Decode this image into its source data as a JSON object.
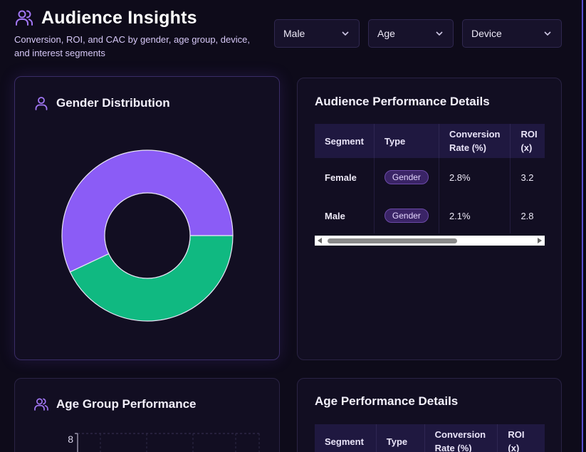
{
  "header": {
    "title": "Audience Insights",
    "subtitle": "Conversion, ROI, and CAC by gender, age group, device, and interest segments"
  },
  "filters": {
    "gender": "Male",
    "age": "Age",
    "device": "Device"
  },
  "gender_card": {
    "title": "Gender Distribution",
    "chart_data": {
      "type": "pie",
      "title": "",
      "categories": [
        "Female",
        "Male"
      ],
      "values": [
        57,
        43
      ],
      "colors": [
        "#8b5cf6",
        "#10b981"
      ],
      "legend": "none"
    }
  },
  "audience_table": {
    "title": "Audience Performance Details",
    "columns": [
      "Segment",
      "Type",
      "Conversion Rate (%)",
      "ROI (x)"
    ],
    "rows": [
      {
        "segment": "Female",
        "type": "Gender",
        "conversion": "2.8%",
        "roi": "3.2"
      },
      {
        "segment": "Male",
        "type": "Gender",
        "conversion": "2.1%",
        "roi": "2.8"
      }
    ]
  },
  "age_card": {
    "title": "Age Group Performance",
    "chart_data": {
      "type": "bar",
      "title": "",
      "y_top_tick": "8"
    }
  },
  "age_table": {
    "title": "Age Performance Details",
    "columns": [
      "Segment",
      "Type",
      "Conversion Rate (%)",
      "ROI (x)"
    ]
  },
  "colors": {
    "accent": "#a277f5",
    "female": "#8b5cf6",
    "male": "#10b981"
  }
}
